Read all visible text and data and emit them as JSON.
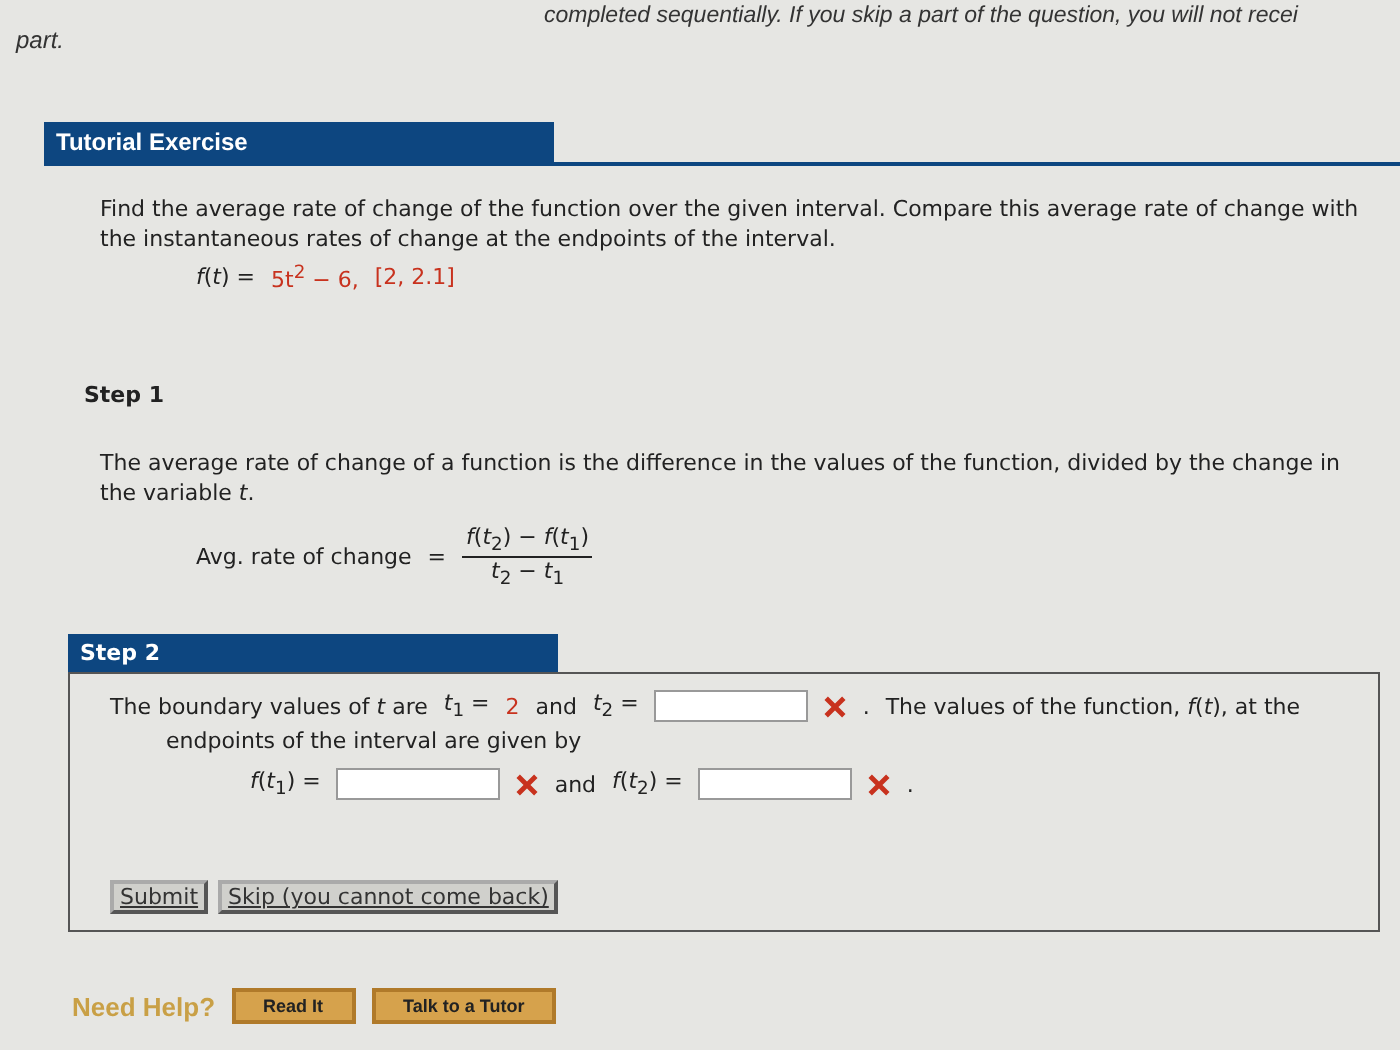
{
  "notice": {
    "top": "completed sequentially. If you skip a part of the question, you will not recei",
    "tail": "part."
  },
  "tutorial": {
    "title": "Tutorial Exercise",
    "prompt": "Find the average rate of change of the function over the given interval. Compare this average rate of change with the instantaneous rates of change at the endpoints of the interval.",
    "function_lhs": "*f*(*t*) =",
    "function_rhs": "5t$^{2}$ − 6,",
    "interval": "[2, 2.1]"
  },
  "step1": {
    "title": "Step 1",
    "text": "The average rate of change of a function is the difference in the values of the function, divided by the change in the variable *t*.",
    "formula_label": "Avg. rate of change",
    "equals": "=",
    "numerator": "*f*(*t*$_{2}$) − *f*(*t*$_{1}$)",
    "denominator": "*t*$_{2}$ − *t*$_{1}$"
  },
  "step2": {
    "title": "Step 2",
    "text_a": "The boundary values of *t* are",
    "t1_label": "*t*$_{1}$ =",
    "t1_value": "2",
    "and_1": "and",
    "t2_label": "*t*$_{2}$ =",
    "dot_1": ".",
    "text_b": "The values of the function, *f*(*t*), at the",
    "text_c": "endpoints of the interval are given by",
    "f1_label": "*f*(*t*$_{1}$) =",
    "and_2": "and",
    "f2_label": "*f*(*t*$_{2}$) =",
    "dot_2": ".",
    "fields": [
      {
        "correct": false
      },
      {
        "correct": false
      },
      {
        "correct": false
      }
    ],
    "buttons": [
      {
        "label": "Submit"
      },
      {
        "label": "Skip (you cannot come back)"
      }
    ]
  },
  "help": {
    "label": "Need Help?",
    "buttons": [
      {
        "label": "Read It"
      },
      {
        "label": "Talk to a Tutor"
      }
    ]
  }
}
